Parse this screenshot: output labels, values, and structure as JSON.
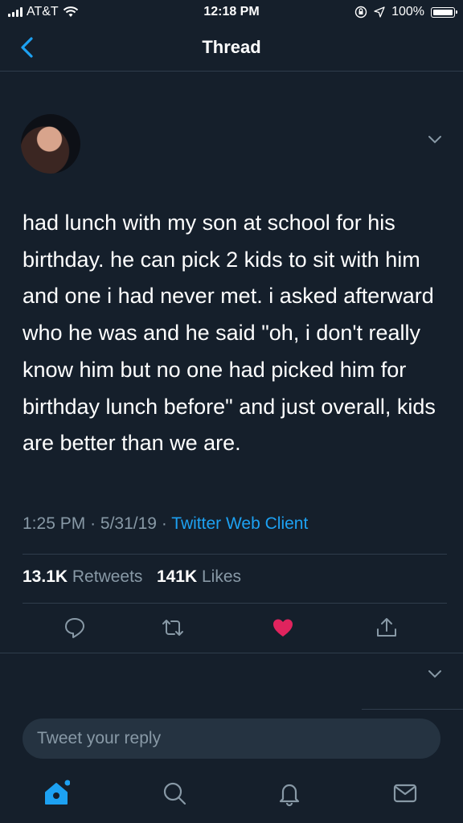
{
  "status_bar": {
    "carrier": "AT&T",
    "time": "12:18 PM",
    "battery": "100%"
  },
  "nav": {
    "title": "Thread"
  },
  "tweet": {
    "text": "had lunch with my son at school for his birthday. he can pick 2 kids to sit with him and one i had never met. i asked afterward who he was and he said \"oh, i don't really know him but no one had picked him for birthday lunch before\" and just overall, kids are better than we are.",
    "time": "1:25 PM",
    "date": "5/31/19",
    "separator": "·",
    "client": "Twitter Web Client",
    "retweets_count": "13.1K",
    "retweets_label": "Retweets",
    "likes_count": "141K",
    "likes_label": "Likes"
  },
  "reply": {
    "placeholder": "Tweet your reply"
  },
  "colors": {
    "background": "#151f2b",
    "accent": "#1da1f2",
    "like": "#e0245e",
    "muted": "#8899a6"
  },
  "icons": {
    "actions": [
      "reply-icon",
      "retweet-icon",
      "like-icon",
      "share-icon"
    ],
    "tabs": [
      "home-icon",
      "search-icon",
      "notifications-icon",
      "messages-icon"
    ]
  }
}
